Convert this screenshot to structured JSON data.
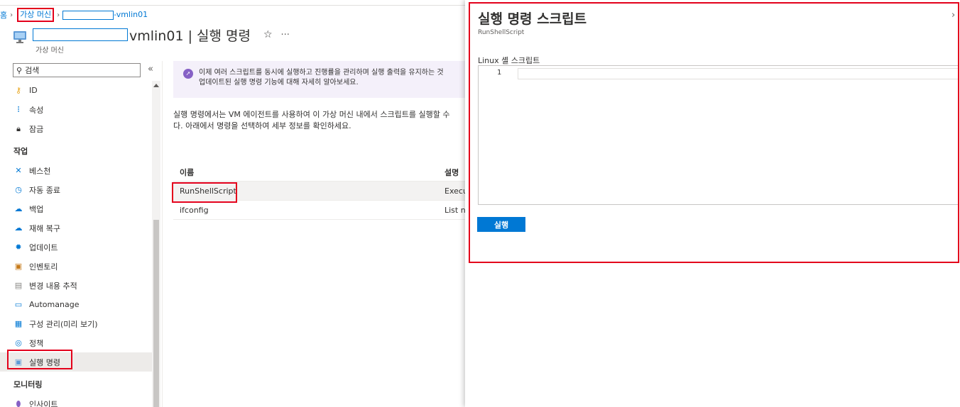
{
  "breadcrumb": {
    "home_partial": "홈",
    "vm_list": "가상 머신",
    "vm_name_suffix": "-vmlin01"
  },
  "header": {
    "title_suffix": "vmlin01 | 실행 명령",
    "subtitle": "가상 머신",
    "favorite_icon": "☆",
    "more_icon": "···"
  },
  "sidebar": {
    "search_placeholder": "검색",
    "collapse_icon": "«",
    "items_top": [
      {
        "label": "ID",
        "icon": "key-icon"
      },
      {
        "label": "속성",
        "icon": "properties-icon"
      },
      {
        "label": "잠금",
        "icon": "lock-icon"
      }
    ],
    "section_ops": "작업",
    "items_ops": [
      {
        "label": "베스천",
        "icon": "bastion-icon"
      },
      {
        "label": "자동 종료",
        "icon": "clock-icon"
      },
      {
        "label": "백업",
        "icon": "cloud-backup-icon"
      },
      {
        "label": "재해 복구",
        "icon": "cloud-recovery-icon"
      },
      {
        "label": "업데이트",
        "icon": "gear-icon"
      },
      {
        "label": "인벤토리",
        "icon": "inventory-icon"
      },
      {
        "label": "변경 내용 추적",
        "icon": "change-tracking-icon"
      },
      {
        "label": "Automanage",
        "icon": "automanage-icon"
      },
      {
        "label": "구성 관리(미리 보기)",
        "icon": "config-icon"
      },
      {
        "label": "정책",
        "icon": "policy-icon"
      },
      {
        "label": "실행 명령",
        "icon": "run-command-icon"
      }
    ],
    "section_monitor": "모니터링",
    "items_monitor": [
      {
        "label": "인사이트",
        "icon": "insights-icon"
      }
    ]
  },
  "banner": {
    "line1": "이제 여러 스크립트를 동시에 실행하고 진행률을 관리하며 실행 출력을 유지하는 것",
    "line2": "업데이트된 실행 명령 기능에 대해 자세히 알아보세요."
  },
  "description": {
    "line1": "실행 명령에서는 VM 에이전트를 사용하여 이 가상 머신 내에서 스크립트를 실행할 수",
    "line2": "다. 아래에서 명령을 선택하여 세부 정보를 확인하세요."
  },
  "table": {
    "col_name": "이름",
    "col_desc": "설명",
    "rows": [
      {
        "name": "RunShellScript",
        "desc": "Execu"
      },
      {
        "name": "ifconfig",
        "desc": "List ne"
      }
    ]
  },
  "panel": {
    "title": "실행 명령 스크립트",
    "subtitle": "RunShellScript",
    "script_label": "Linux 셸 스크립트",
    "line_number": "1",
    "run_label": "실행",
    "close_icon": "›"
  }
}
